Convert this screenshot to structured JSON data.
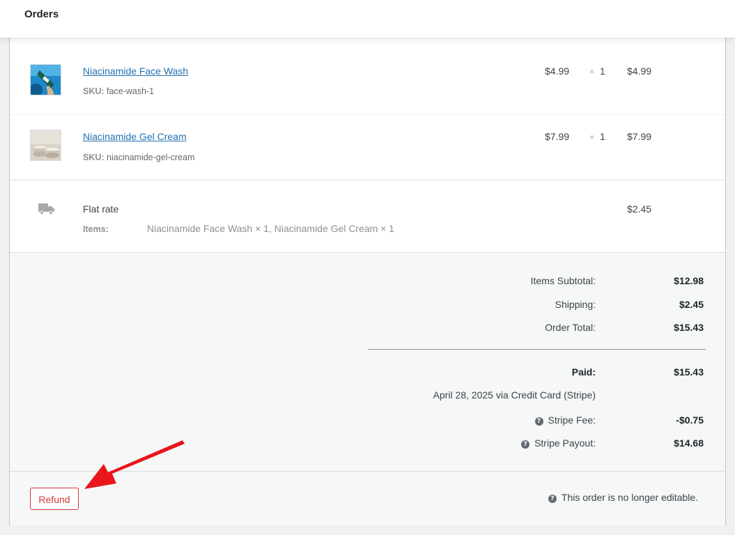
{
  "header": {
    "title": "Orders"
  },
  "line_items": [
    {
      "name": "Niacinamide Face Wash",
      "sku_label": "SKU:",
      "sku": "face-wash-1",
      "price": "$4.99",
      "qty_sign": "×",
      "qty": "1",
      "total": "$4.99"
    },
    {
      "name": "Niacinamide Gel Cream",
      "sku_label": "SKU:",
      "sku": "niacinamide-gel-cream",
      "price": "$7.99",
      "qty_sign": "×",
      "qty": "1",
      "total": "$7.99"
    }
  ],
  "shipping": {
    "method": "Flat rate",
    "items_label": "Items:",
    "items_value": "Niacinamide Face Wash × 1, Niacinamide Gel Cream × 1",
    "cost": "$2.45"
  },
  "totals": {
    "items_subtotal_label": "Items Subtotal:",
    "items_subtotal": "$12.98",
    "shipping_label": "Shipping:",
    "shipping": "$2.45",
    "order_total_label": "Order Total:",
    "order_total": "$15.43",
    "paid_label": "Paid:",
    "paid": "$15.43",
    "paid_note": "April 28, 2025 via Credit Card (Stripe)",
    "stripe_fee_label": "Stripe Fee:",
    "stripe_fee": "-$0.75",
    "stripe_payout_label": "Stripe Payout:",
    "stripe_payout": "$14.68",
    "help_glyph": "?"
  },
  "actions": {
    "refund_label": "Refund",
    "not_editable": "This order is no longer editable."
  },
  "colors": {
    "link": "#2271b1",
    "refund": "#d63638",
    "arrow": "#e8151b"
  }
}
